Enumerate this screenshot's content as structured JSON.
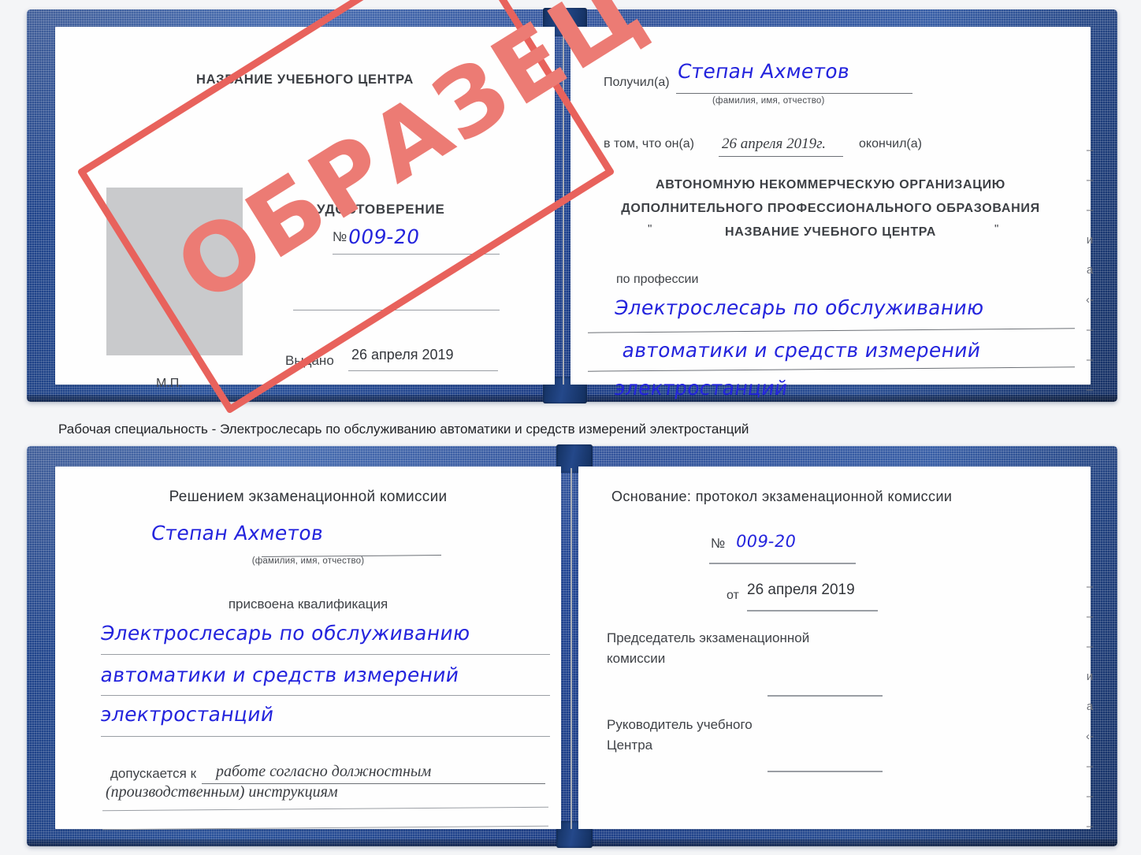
{
  "document": {
    "kind": "udostoverenie-certificate-sample",
    "watermark": "ОБРАЗЕЦ",
    "colors": {
      "cover_blue": "#1d4190",
      "handwriting_blue": "#2424dd",
      "watermark_red": "#e8625c",
      "page_white": "#fefefe",
      "background": "#f4f5f7",
      "photo_placeholder": "#c9cacc",
      "rule_grey": "#9a9ea4"
    }
  },
  "cert_top": {
    "left_page": {
      "center_name": "НАЗВАНИЕ УЧЕБНОГО ЦЕНТРА",
      "title": "УДОСТОВЕРЕНИЕ",
      "number_label": "№",
      "number_value": "009-20",
      "issued_label": "Выдано",
      "issued_value": "26 апреля 2019",
      "stamp_label": "М.П."
    },
    "right_page": {
      "received_label": "Получил(а)",
      "received_value": "Степан Ахметов",
      "fio_hint": "(фамилия, имя, отчество)",
      "that_he_label": "в том, что он(а)",
      "that_he_value": "26 апреля 2019г.",
      "finished_label": "окончил(а)",
      "org_line1": "АВТОНОМНУЮ НЕКОММЕРЧЕСКУЮ ОРГАНИЗАЦИЮ",
      "org_line2": "ДОПОЛНИТЕЛЬНОГО ПРОФЕССИОНАЛЬНОГО ОБРАЗОВАНИЯ",
      "org_quote_open": "\"",
      "org_line3": "НАЗВАНИЕ УЧЕБНОГО ЦЕНТРА",
      "org_quote_close": "\"",
      "profession_label": "по профессии",
      "profession_line1": "Электрослесарь по обслуживанию",
      "profession_line2": "автоматики и средств измерений",
      "profession_line3": "электростанций",
      "margin_glyphs": [
        "–",
        "–",
        "–",
        "и",
        "а",
        "‹-",
        "–",
        "–",
        "–",
        "–"
      ]
    }
  },
  "caption": {
    "text": "Рабочая специальность - Электрослесарь по обслуживанию автоматики и средств измерений электростанций"
  },
  "cert_bottom": {
    "left_page": {
      "heading": "Решением экзаменационной комиссии",
      "name_value": "Степан Ахметов",
      "fio_hint": "(фамилия, имя, отчество)",
      "qualification_label": "присвоена квалификация",
      "qualification_line1": "Электрослесарь по обслуживанию",
      "qualification_line2": "автоматики и средств измерений",
      "qualification_line3": "электростанций",
      "admitted_label": "допускается к",
      "admitted_value_line1": "работе согласно должностным",
      "admitted_value_line2": "(производственным) инструкциям"
    },
    "right_page": {
      "basis_label": "Основание: протокол экзаменационной комиссии",
      "number_label": "№",
      "number_value": "009-20",
      "date_label": "от",
      "date_value": "26 апреля 2019",
      "chairman_line1": "Председатель экзаменационной",
      "chairman_line2": "комиссии",
      "head_line1": "Руководитель учебного",
      "head_line2": "Центра",
      "margin_glyphs": [
        "–",
        "–",
        "–",
        "и",
        "а",
        "‹-",
        "–",
        "–",
        "–",
        "–"
      ]
    }
  }
}
